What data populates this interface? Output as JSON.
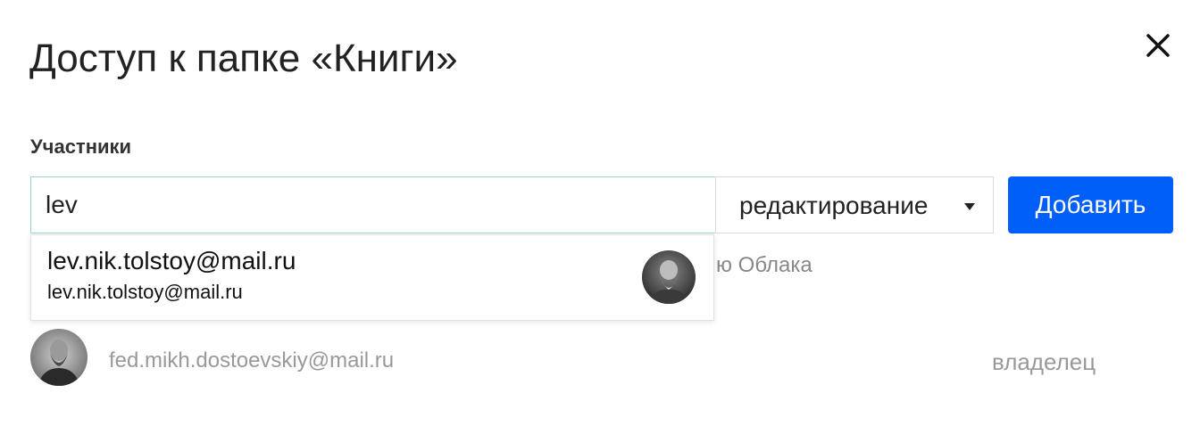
{
  "dialog": {
    "title": "Доступ к папке «Книги»",
    "close_icon": "close-icon"
  },
  "members_section": {
    "label": "Участники"
  },
  "invite": {
    "input_value": "lev",
    "role_value": "редактирование",
    "role_icon": "chevron-down-icon",
    "add_label": "Добавить",
    "hint_fragment": "ю Облака"
  },
  "suggestions": [
    {
      "name": "lev.nik.tolstoy@mail.ru",
      "email": "lev.nik.tolstoy@mail.ru",
      "avatar": "avatar-photo"
    }
  ],
  "members": [
    {
      "email": "fed.mikh.dostoevskiy@mail.ru",
      "role": "владелец",
      "avatar": "avatar-photo"
    }
  ],
  "colors": {
    "accent": "#005ff9",
    "input_border_focus": "#9ad3d6",
    "muted_text": "#999999"
  }
}
